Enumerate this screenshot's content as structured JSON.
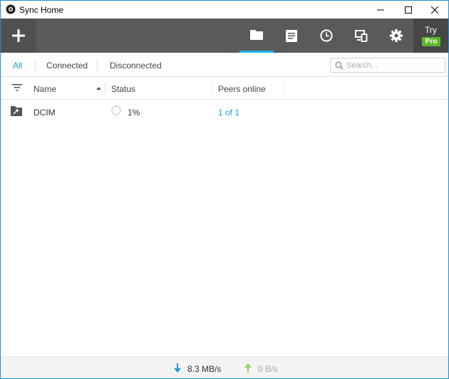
{
  "window": {
    "title": "Sync Home"
  },
  "toolbar": {
    "add_icon": "plus-icon",
    "buttons": [
      {
        "name": "folders",
        "icon": "folder-icon",
        "active": true
      },
      {
        "name": "transfers",
        "icon": "document-icon",
        "active": false
      },
      {
        "name": "history",
        "icon": "clock-icon",
        "active": false
      },
      {
        "name": "devices",
        "icon": "devices-icon",
        "active": false
      },
      {
        "name": "settings",
        "icon": "gear-icon",
        "active": false
      }
    ],
    "try_label": "Try",
    "pro_label": "Pro"
  },
  "filters": {
    "tabs": [
      "All",
      "Connected",
      "Disconnected"
    ],
    "active": "All"
  },
  "search": {
    "placeholder": "Search...",
    "value": ""
  },
  "table": {
    "columns": [
      "Name",
      "Status",
      "Peers online"
    ],
    "sort_column": "Name",
    "rows": [
      {
        "name": "DCIM",
        "status": "1%",
        "peers": "1 of 1"
      }
    ]
  },
  "statusbar": {
    "download": "8.3 MB/s",
    "upload": "0 B/s"
  },
  "colors": {
    "accent": "#1a9bd7",
    "toolbar": "#5a5a5a",
    "pro_badge": "#5bb82e",
    "active_underline": "#1ab3e6"
  }
}
